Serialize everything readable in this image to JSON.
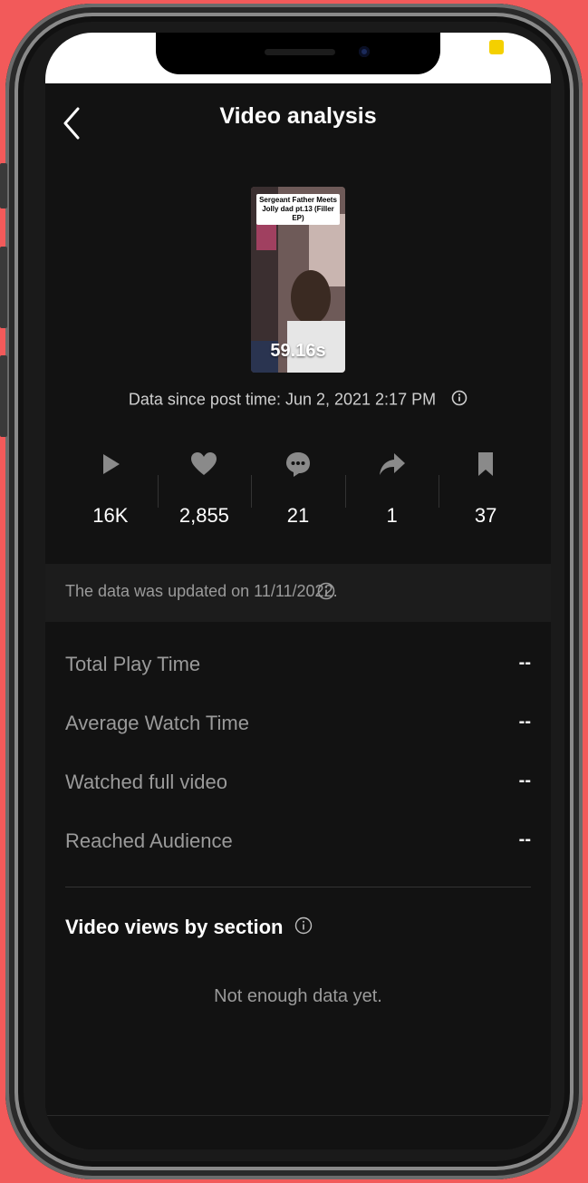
{
  "header": {
    "title": "Video analysis"
  },
  "video": {
    "caption": "Sergeant Father Meets Jolly dad pt.13 (Filler EP)",
    "duration": "59.16s",
    "since": "Data since post time: Jun 2, 2021 2:17 PM"
  },
  "stats": [
    {
      "icon": "play-icon",
      "value": "16K"
    },
    {
      "icon": "heart-icon",
      "value": "2,855"
    },
    {
      "icon": "comment-icon",
      "value": "21"
    },
    {
      "icon": "share-icon",
      "value": "1"
    },
    {
      "icon": "bookmark-icon",
      "value": "37"
    }
  ],
  "updated": "The data was updated on 11/11/2022.",
  "metrics": [
    {
      "label": "Total Play Time",
      "value": "--"
    },
    {
      "label": "Average Watch Time",
      "value": "--"
    },
    {
      "label": "Watched full video",
      "value": "--"
    },
    {
      "label": "Reached Audience",
      "value": "--"
    }
  ],
  "section": {
    "title": "Video views by section",
    "empty": "Not enough data yet."
  },
  "colors": {
    "background": "#121212",
    "frame_bg": "#f25a5a",
    "status_indicator": "#f4d000"
  }
}
